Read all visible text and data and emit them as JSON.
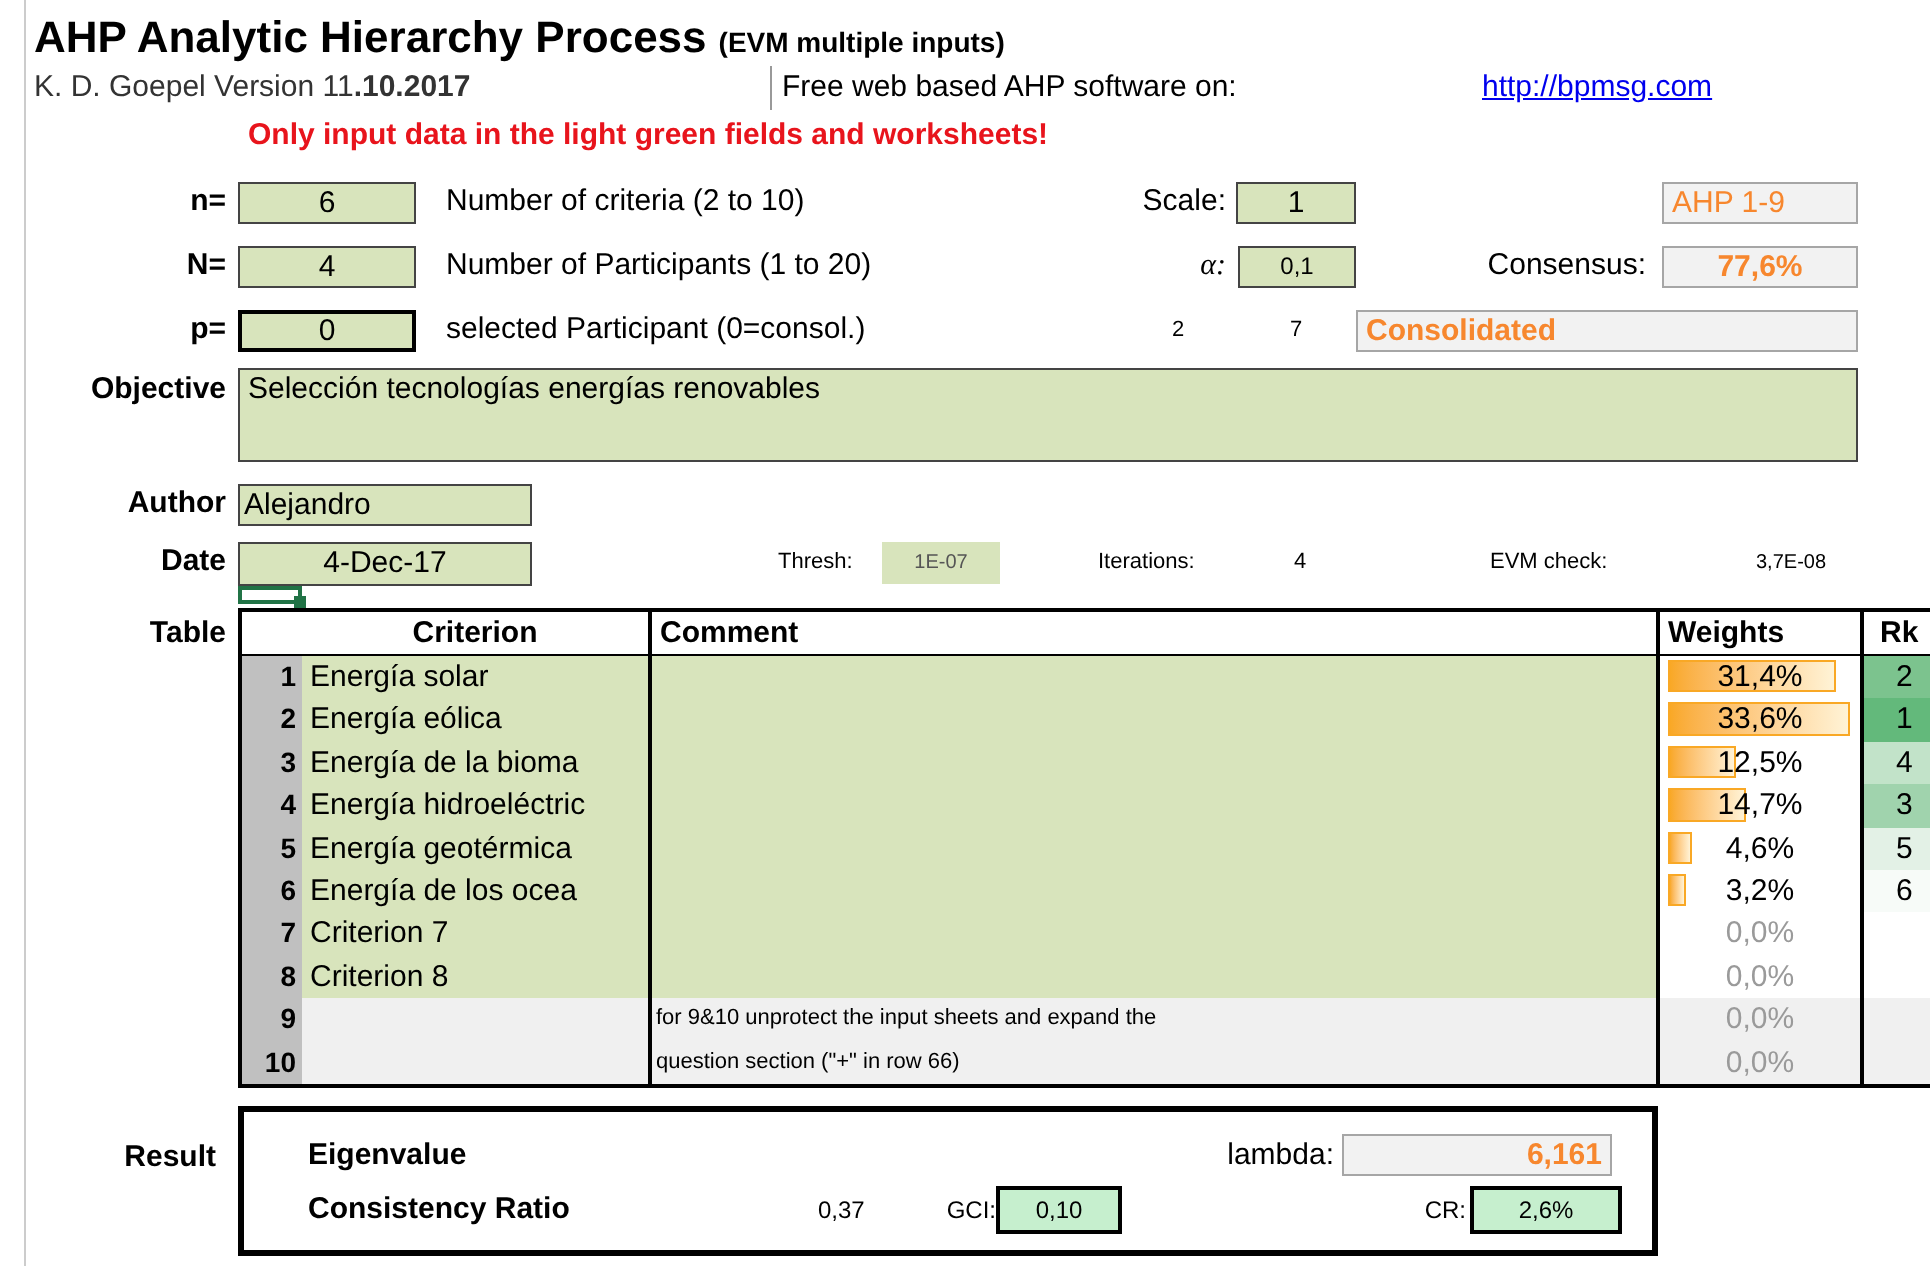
{
  "title": {
    "main": "AHP Analytic Hierarchy Process",
    "sub": "(EVM multiple inputs)"
  },
  "byline": "K. D. Goepel Version 11**.10.2017**",
  "web_label": "Free web based AHP software on:",
  "link": "http://bpmsg.com",
  "warning": "Only input data in the light green fields and worksheets!",
  "n": {
    "label": "n=",
    "value": "6",
    "description": "Number of criteria (2 to 10)"
  },
  "N": {
    "label": "N=",
    "value": "4",
    "description": "Number of Participants (1 to 20)"
  },
  "p": {
    "label": "p=",
    "value": "0",
    "description": "selected Participant (0=consol.)"
  },
  "scale": {
    "label": "Scale:",
    "value": "1",
    "name": "AHP 1-9"
  },
  "alpha": {
    "label": "α:",
    "value": "0,1"
  },
  "consensus": {
    "label": "Consensus:",
    "value": "77,6%"
  },
  "participant_counts": [
    "2",
    "7"
  ],
  "participant_name": "Consolidated",
  "objective": {
    "label": "Objective",
    "value": "Selección tecnologías energías renovables"
  },
  "author": {
    "label": "Author",
    "value": "Alejandro"
  },
  "date": {
    "label": "Date",
    "value": "4-Dec-17"
  },
  "thresh": {
    "label": "Thresh:",
    "value": "1E-07"
  },
  "iterations": {
    "label": "Iterations:",
    "value": "4"
  },
  "evm_check": {
    "label": "EVM check:",
    "value": "3,7E-08"
  },
  "table": {
    "label": "Table",
    "columns": [
      "Criterion",
      "Comment",
      "Weights",
      "Rk"
    ],
    "rows": [
      {
        "number": "1",
        "criterion": "Energía solar",
        "comment": "",
        "weight": "31,4%",
        "level": 0.88,
        "disabled": false,
        "rank": "2",
        "color": "#7cc38e",
        "kind": "input"
      },
      {
        "number": "2",
        "criterion": "Energía eólica",
        "comment": "",
        "weight": "33,6%",
        "level": 0.95,
        "disabled": false,
        "rank": "1",
        "color": "#63b97b",
        "kind": "input"
      },
      {
        "number": "3",
        "criterion": "Energía de la bioma",
        "comment": "",
        "weight": "12,5%",
        "level": 0.35,
        "disabled": false,
        "rank": "4",
        "color": "#c2e3c9",
        "kind": "input"
      },
      {
        "number": "4",
        "criterion": "Energía hidroeléctric",
        "comment": "",
        "weight": "14,7%",
        "level": 0.41,
        "disabled": false,
        "rank": "3",
        "color": "#a0d3ad",
        "kind": "input"
      },
      {
        "number": "5",
        "criterion": "Energía geotérmica",
        "comment": "",
        "weight": "4,6%",
        "level": 0.13,
        "disabled": false,
        "rank": "5",
        "color": "#e3f1e6",
        "kind": "input"
      },
      {
        "number": "6",
        "criterion": "Energía de los ocea",
        "comment": "",
        "weight": "3,2%",
        "level": 0.09,
        "disabled": false,
        "rank": "6",
        "color": "#f7fbf8",
        "kind": "input"
      },
      {
        "number": "7",
        "criterion": "Criterion 7",
        "comment": "",
        "weight": "0,0%",
        "disabled": true,
        "kind": "input"
      },
      {
        "number": "8",
        "criterion": "Criterion 8",
        "comment": "",
        "weight": "0,0%",
        "disabled": true,
        "kind": "input"
      },
      {
        "number": "9",
        "criterion": "",
        "comment": "for 9&10 unprotect the input sheets and expand the",
        "weight": "0,0%",
        "disabled": true,
        "kind": "locked"
      },
      {
        "number": "10",
        "criterion": "",
        "comment": "question section (\"+\" in row 66)",
        "weight": "0,0%",
        "disabled": true,
        "kind": "locked"
      }
    ]
  },
  "result": {
    "label": "Result",
    "eigenvalue_label": "Eigenvalue",
    "lambda_label": "lambda:",
    "lambda": "6,161",
    "cr_title": "Consistency Ratio",
    "gci_raw": "0,37",
    "gci_label": "GCI:",
    "gci": "0,10",
    "cr_label": "CR:",
    "cr": "2,6%"
  }
}
